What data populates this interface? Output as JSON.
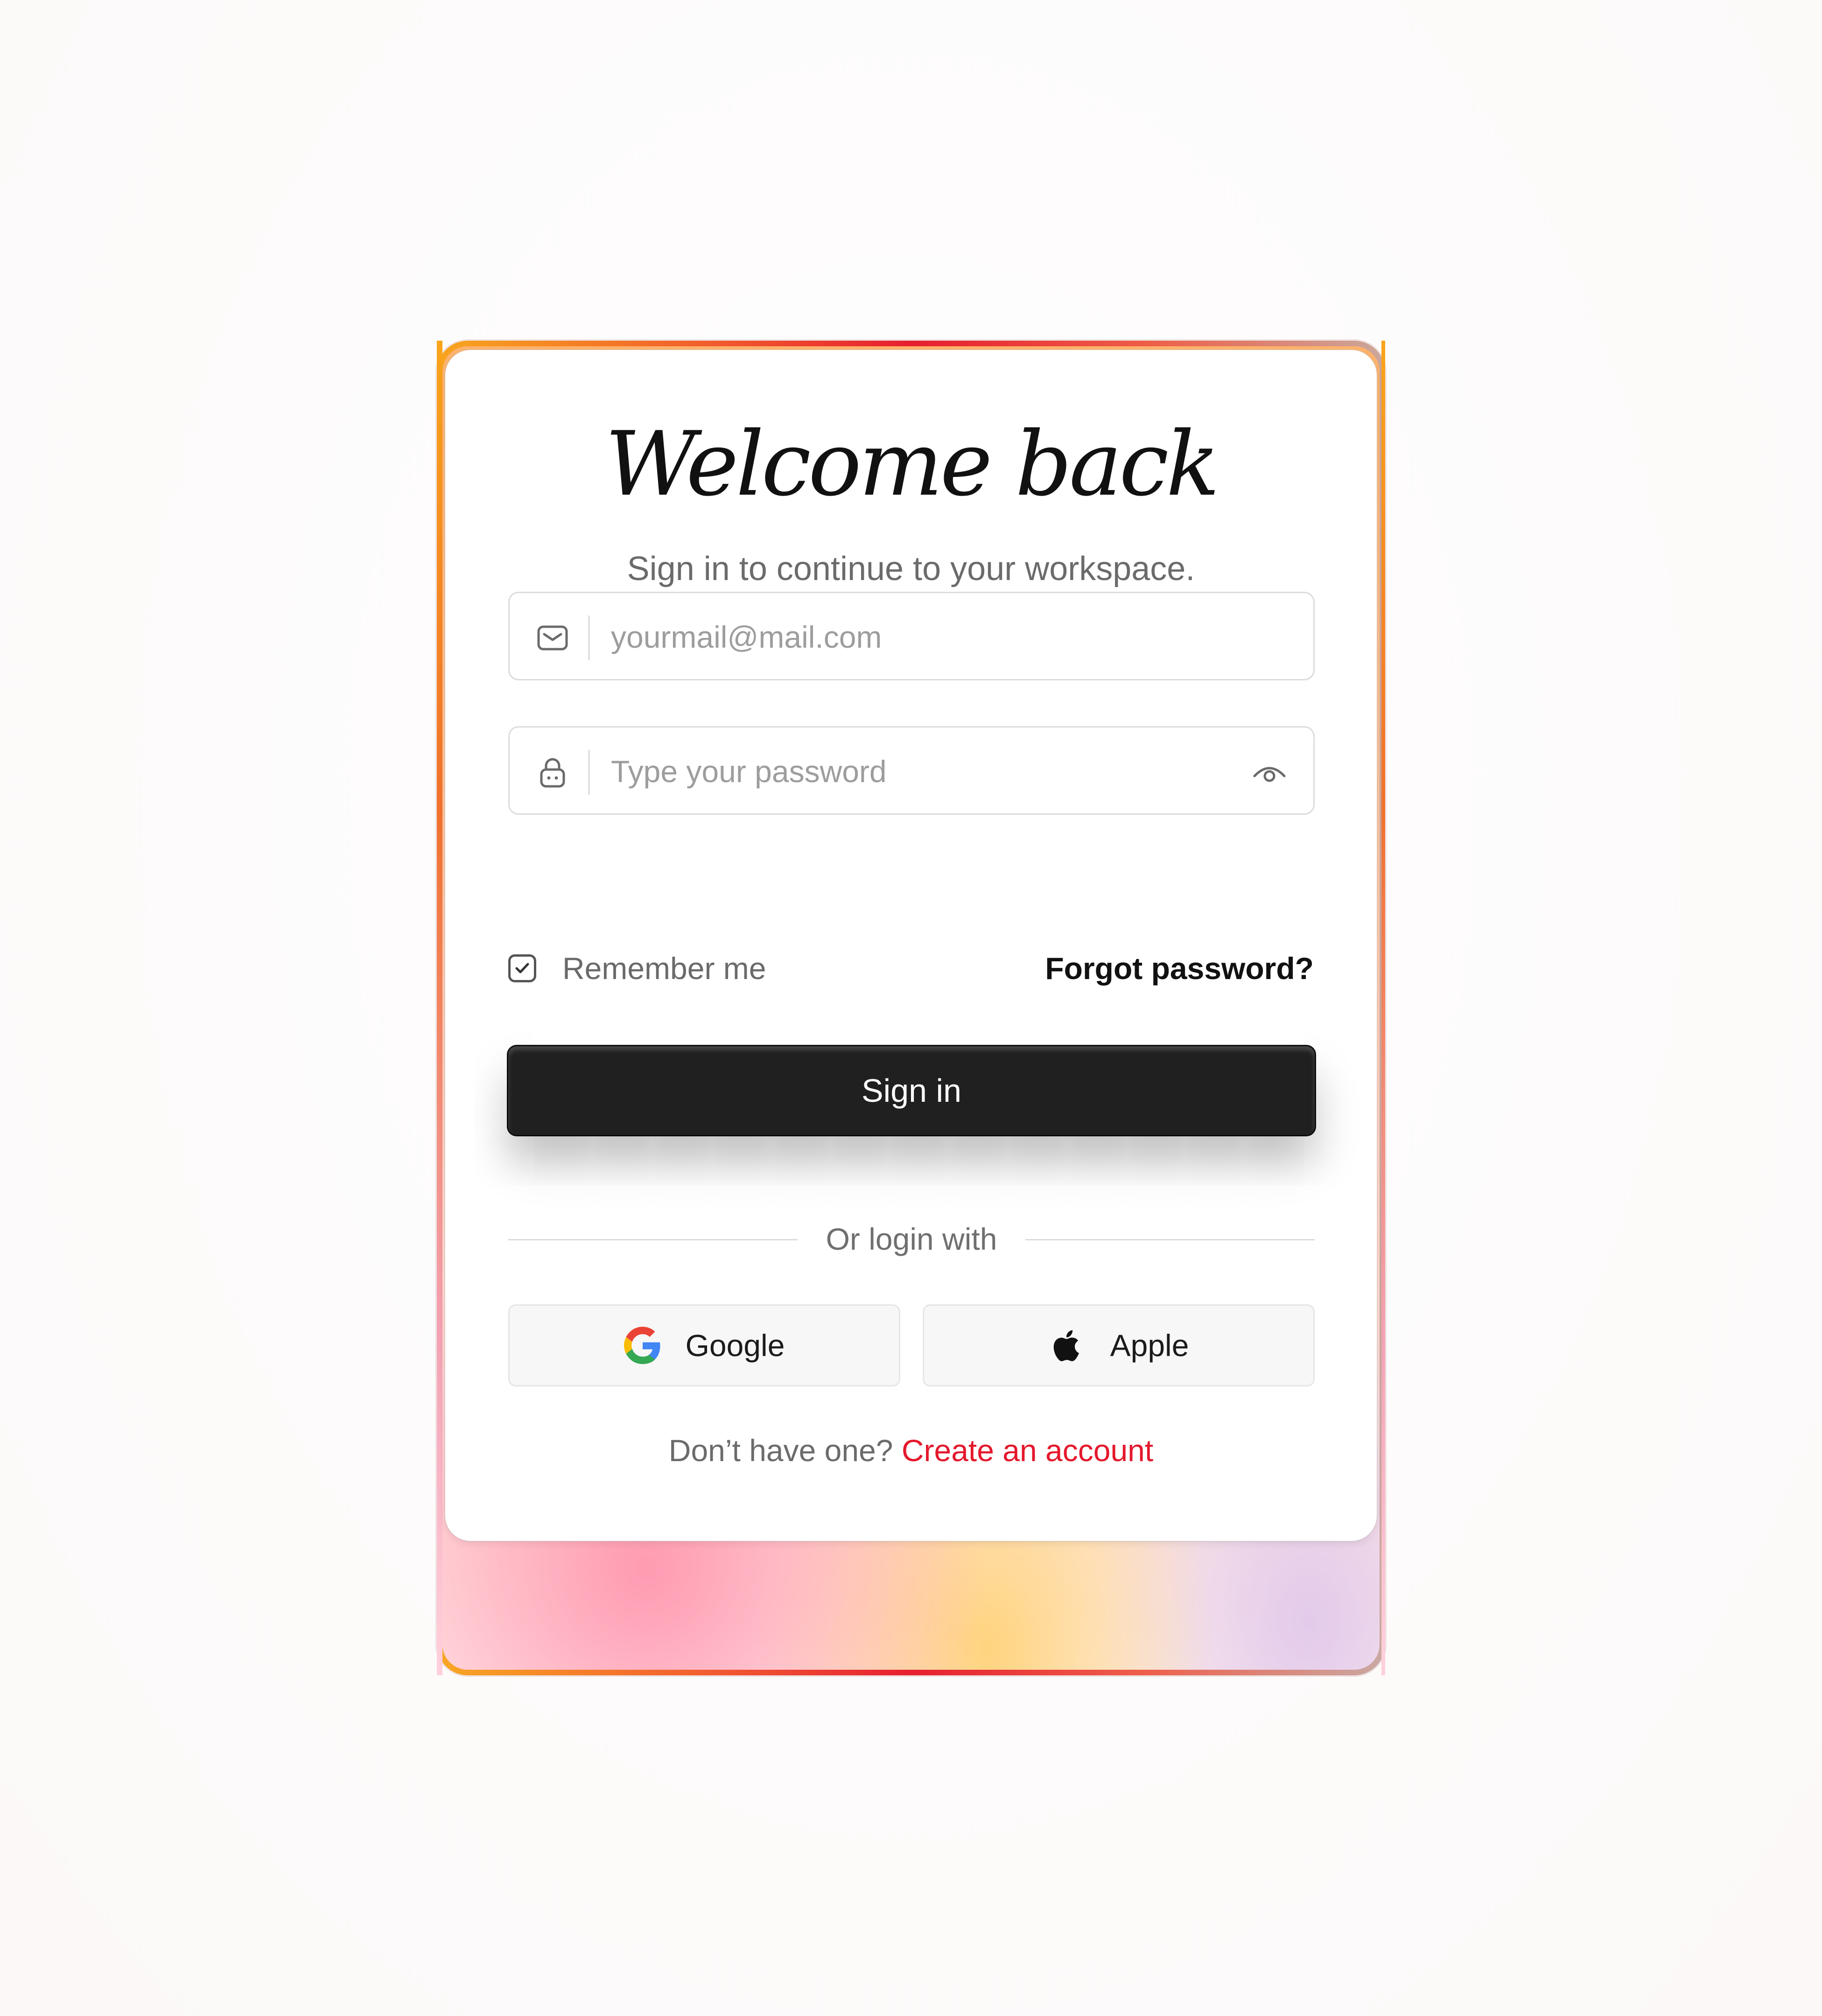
{
  "login": {
    "title": "Welcome back",
    "subtitle": "Sign in to continue to your workspace.",
    "email": {
      "placeholder": "yourmail@mail.com",
      "value": "",
      "icon": "mail-icon"
    },
    "password": {
      "placeholder": "Type your password",
      "value": "",
      "icon": "lock-icon",
      "toggle_icon": "eye-icon"
    },
    "remember_label": "Remember me",
    "remember_checked": true,
    "forgot_label": "Forgot password?",
    "signin_label": "Sign in",
    "divider_label": "Or login with",
    "social": {
      "google_label": "Google",
      "apple_label": "Apple"
    },
    "signup_prompt": "Don’t have one?",
    "signup_link": "Create an account"
  },
  "colors": {
    "accent": "#e4182c",
    "button_bg": "#202020",
    "frame_top": "#e5172c",
    "frame_left": "#f9a51a"
  }
}
